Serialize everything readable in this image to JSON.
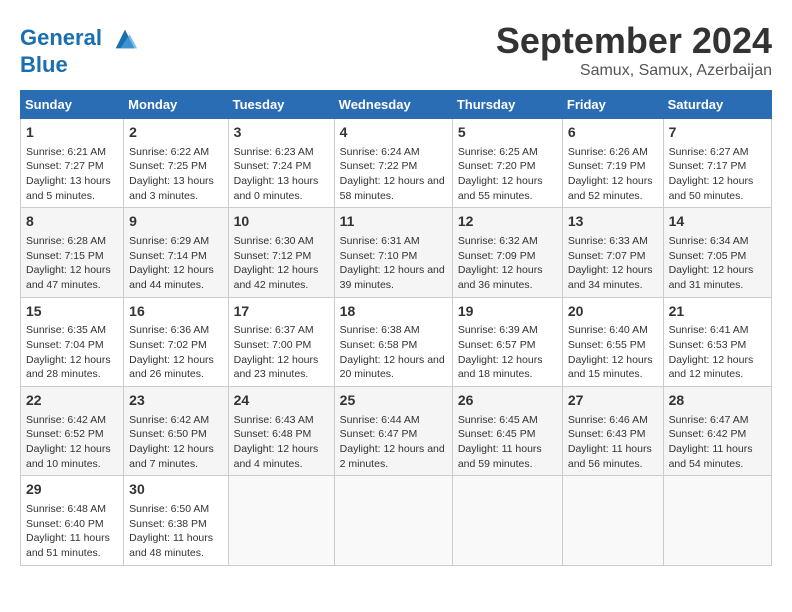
{
  "header": {
    "logo_line1": "General",
    "logo_line2": "Blue",
    "month": "September 2024",
    "location": "Samux, Samux, Azerbaijan"
  },
  "days_of_week": [
    "Sunday",
    "Monday",
    "Tuesday",
    "Wednesday",
    "Thursday",
    "Friday",
    "Saturday"
  ],
  "weeks": [
    [
      {
        "day": "1",
        "sunrise": "6:21 AM",
        "sunset": "7:27 PM",
        "daylight": "13 hours and 5 minutes."
      },
      {
        "day": "2",
        "sunrise": "6:22 AM",
        "sunset": "7:25 PM",
        "daylight": "13 hours and 3 minutes."
      },
      {
        "day": "3",
        "sunrise": "6:23 AM",
        "sunset": "7:24 PM",
        "daylight": "13 hours and 0 minutes."
      },
      {
        "day": "4",
        "sunrise": "6:24 AM",
        "sunset": "7:22 PM",
        "daylight": "12 hours and 58 minutes."
      },
      {
        "day": "5",
        "sunrise": "6:25 AM",
        "sunset": "7:20 PM",
        "daylight": "12 hours and 55 minutes."
      },
      {
        "day": "6",
        "sunrise": "6:26 AM",
        "sunset": "7:19 PM",
        "daylight": "12 hours and 52 minutes."
      },
      {
        "day": "7",
        "sunrise": "6:27 AM",
        "sunset": "7:17 PM",
        "daylight": "12 hours and 50 minutes."
      }
    ],
    [
      {
        "day": "8",
        "sunrise": "6:28 AM",
        "sunset": "7:15 PM",
        "daylight": "12 hours and 47 minutes."
      },
      {
        "day": "9",
        "sunrise": "6:29 AM",
        "sunset": "7:14 PM",
        "daylight": "12 hours and 44 minutes."
      },
      {
        "day": "10",
        "sunrise": "6:30 AM",
        "sunset": "7:12 PM",
        "daylight": "12 hours and 42 minutes."
      },
      {
        "day": "11",
        "sunrise": "6:31 AM",
        "sunset": "7:10 PM",
        "daylight": "12 hours and 39 minutes."
      },
      {
        "day": "12",
        "sunrise": "6:32 AM",
        "sunset": "7:09 PM",
        "daylight": "12 hours and 36 minutes."
      },
      {
        "day": "13",
        "sunrise": "6:33 AM",
        "sunset": "7:07 PM",
        "daylight": "12 hours and 34 minutes."
      },
      {
        "day": "14",
        "sunrise": "6:34 AM",
        "sunset": "7:05 PM",
        "daylight": "12 hours and 31 minutes."
      }
    ],
    [
      {
        "day": "15",
        "sunrise": "6:35 AM",
        "sunset": "7:04 PM",
        "daylight": "12 hours and 28 minutes."
      },
      {
        "day": "16",
        "sunrise": "6:36 AM",
        "sunset": "7:02 PM",
        "daylight": "12 hours and 26 minutes."
      },
      {
        "day": "17",
        "sunrise": "6:37 AM",
        "sunset": "7:00 PM",
        "daylight": "12 hours and 23 minutes."
      },
      {
        "day": "18",
        "sunrise": "6:38 AM",
        "sunset": "6:58 PM",
        "daylight": "12 hours and 20 minutes."
      },
      {
        "day": "19",
        "sunrise": "6:39 AM",
        "sunset": "6:57 PM",
        "daylight": "12 hours and 18 minutes."
      },
      {
        "day": "20",
        "sunrise": "6:40 AM",
        "sunset": "6:55 PM",
        "daylight": "12 hours and 15 minutes."
      },
      {
        "day": "21",
        "sunrise": "6:41 AM",
        "sunset": "6:53 PM",
        "daylight": "12 hours and 12 minutes."
      }
    ],
    [
      {
        "day": "22",
        "sunrise": "6:42 AM",
        "sunset": "6:52 PM",
        "daylight": "12 hours and 10 minutes."
      },
      {
        "day": "23",
        "sunrise": "6:42 AM",
        "sunset": "6:50 PM",
        "daylight": "12 hours and 7 minutes."
      },
      {
        "day": "24",
        "sunrise": "6:43 AM",
        "sunset": "6:48 PM",
        "daylight": "12 hours and 4 minutes."
      },
      {
        "day": "25",
        "sunrise": "6:44 AM",
        "sunset": "6:47 PM",
        "daylight": "12 hours and 2 minutes."
      },
      {
        "day": "26",
        "sunrise": "6:45 AM",
        "sunset": "6:45 PM",
        "daylight": "11 hours and 59 minutes."
      },
      {
        "day": "27",
        "sunrise": "6:46 AM",
        "sunset": "6:43 PM",
        "daylight": "11 hours and 56 minutes."
      },
      {
        "day": "28",
        "sunrise": "6:47 AM",
        "sunset": "6:42 PM",
        "daylight": "11 hours and 54 minutes."
      }
    ],
    [
      {
        "day": "29",
        "sunrise": "6:48 AM",
        "sunset": "6:40 PM",
        "daylight": "11 hours and 51 minutes."
      },
      {
        "day": "30",
        "sunrise": "6:50 AM",
        "sunset": "6:38 PM",
        "daylight": "11 hours and 48 minutes."
      },
      null,
      null,
      null,
      null,
      null
    ]
  ]
}
